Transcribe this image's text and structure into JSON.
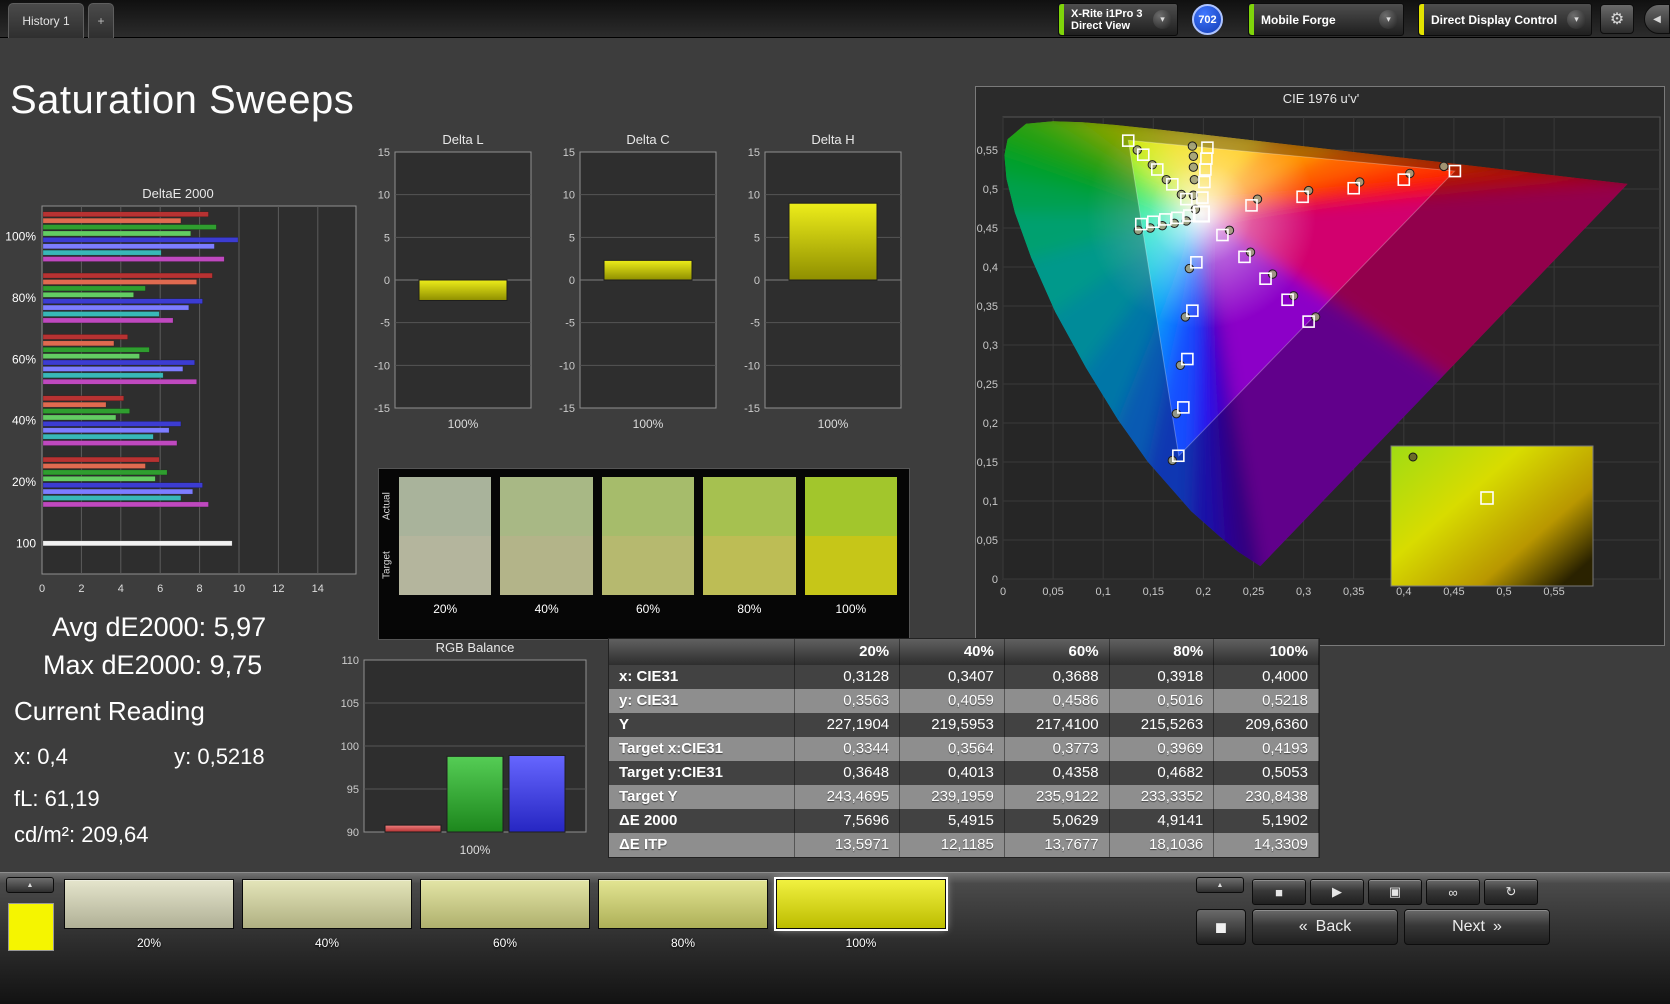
{
  "titlebar": {
    "tab": "History 1",
    "add_tab": "+",
    "meter_line1": "X-Rite i1Pro 3",
    "meter_line2": "Direct View",
    "badge": "702",
    "source_label": "Mobile Forge",
    "display_control_label": "Direct Display Control",
    "accent_green": "#7fd40a",
    "accent_yellow": "#e3e300"
  },
  "icons": {
    "dropdown": "▾",
    "gear": "⚙",
    "collapse": "◀",
    "up": "▲",
    "stop": "■",
    "play": "▶",
    "save": "▣",
    "loop": "∞",
    "refresh": "↻",
    "prev": "«",
    "next": "»",
    "square": "◼"
  },
  "page_title": "Saturation Sweeps",
  "readings": {
    "avg_label": "Avg dE2000: 5,97",
    "max_label": "Max dE2000: 9,75",
    "current_title": "Current Reading",
    "x": "x: 0,4",
    "y": "y: 0,5218",
    "fl": "fL: 61,19",
    "cdm2": "cd/m²: 209,64"
  },
  "chart_data": [
    {
      "id": "deltae2000",
      "type": "bar",
      "orientation": "horizontal",
      "title": "DeltaE 2000",
      "xlim": [
        0,
        14
      ],
      "xticks": [
        0,
        2,
        4,
        6,
        8,
        10,
        12,
        14
      ],
      "bar_colors": [
        "#b83232",
        "#e06a50",
        "#2f9e2f",
        "#63cc63",
        "#3c3cd2",
        "#7d7dff",
        "#38b8b8",
        "#bf49bf"
      ],
      "groups": [
        {
          "label": "100%",
          "values": [
            8.4,
            7.0,
            8.8,
            7.5,
            9.9,
            8.7,
            6.0,
            9.2
          ]
        },
        {
          "label": "80%",
          "values": [
            8.6,
            7.8,
            5.2,
            4.6,
            8.1,
            7.4,
            5.9,
            6.6
          ]
        },
        {
          "label": "60%",
          "values": [
            4.3,
            3.6,
            5.4,
            4.9,
            7.7,
            7.1,
            6.1,
            7.8
          ]
        },
        {
          "label": "40%",
          "values": [
            4.1,
            3.2,
            4.4,
            3.7,
            7.0,
            6.4,
            5.6,
            6.8
          ]
        },
        {
          "label": "20%",
          "values": [
            5.9,
            5.2,
            6.3,
            5.7,
            8.1,
            7.6,
            7.0,
            8.4
          ]
        },
        {
          "label": "100",
          "values": [
            9.6
          ],
          "colors": [
            "#f2f2f2"
          ]
        }
      ]
    },
    {
      "id": "delta_l",
      "type": "bar",
      "title": "Delta L",
      "ylim": [
        -15,
        15
      ],
      "yticks": [
        15,
        10,
        5,
        0,
        -5,
        -10,
        -15
      ],
      "categories": [
        "100%"
      ],
      "values": [
        -2.4
      ],
      "bar_color": "#d9d900"
    },
    {
      "id": "delta_c",
      "type": "bar",
      "title": "Delta C",
      "ylim": [
        -15,
        15
      ],
      "yticks": [
        15,
        10,
        5,
        0,
        -5,
        -10,
        -15
      ],
      "categories": [
        "100%"
      ],
      "values": [
        2.3
      ],
      "bar_color": "#d9d900"
    },
    {
      "id": "delta_h",
      "type": "bar",
      "title": "Delta H",
      "ylim": [
        -15,
        15
      ],
      "yticks": [
        15,
        10,
        5,
        0,
        -5,
        -10,
        -15
      ],
      "categories": [
        "100%"
      ],
      "values": [
        9.0
      ],
      "bar_color": "#d9d900"
    },
    {
      "id": "rgb_balance",
      "type": "bar",
      "title": "RGB Balance",
      "ylim": [
        90,
        110
      ],
      "yticks": [
        110,
        105,
        100,
        95,
        90
      ],
      "categories": [
        "100%"
      ],
      "series": [
        {
          "name": "Red",
          "value": 90.8,
          "color1": "#f08080",
          "color2": "#b43030"
        },
        {
          "name": "Green",
          "value": 98.8,
          "color1": "#55cd55",
          "color2": "#1d871d"
        },
        {
          "name": "Blue",
          "value": 98.9,
          "color1": "#6666ff",
          "color2": "#2626c2"
        }
      ]
    },
    {
      "id": "cie1976",
      "type": "scatter",
      "title": "CIE 1976 u'v'",
      "xticks": [
        "0",
        "0,05",
        "0,1",
        "0,15",
        "0,2",
        "0,25",
        "0,3",
        "0,35",
        "0,4",
        "0,45",
        "0,5",
        "0,55"
      ],
      "yticks": [
        "0",
        "0,05",
        "0,1",
        "0,15",
        "0,2",
        "0,25",
        "0,3",
        "0,35",
        "0,4",
        "0,45",
        "0,5",
        "0,55"
      ],
      "locus_uv": [
        [
          0.2568,
          0.0165
        ],
        [
          0.2347,
          0.035
        ],
        [
          0.2161,
          0.0549
        ],
        [
          0.1877,
          0.0871
        ],
        [
          0.1441,
          0.151
        ],
        [
          0.1147,
          0.2044
        ],
        [
          0.0828,
          0.2708
        ],
        [
          0.0521,
          0.3427
        ],
        [
          0.0282,
          0.4117
        ],
        [
          0.0119,
          0.4699
        ],
        [
          0.0035,
          0.5131
        ],
        [
          0.0014,
          0.5432
        ],
        [
          0.0046,
          0.5639
        ],
        [
          0.0231,
          0.5837
        ],
        [
          0.0501,
          0.5868
        ],
        [
          0.0792,
          0.5856
        ],
        [
          0.1127,
          0.5821
        ],
        [
          0.1531,
          0.5766
        ],
        [
          0.2026,
          0.5694
        ],
        [
          0.2623,
          0.5604
        ],
        [
          0.3315,
          0.5501
        ],
        [
          0.4035,
          0.5393
        ],
        [
          0.4691,
          0.5296
        ],
        [
          0.5203,
          0.5219
        ],
        [
          0.583,
          0.5125
        ],
        [
          0.6234,
          0.5065
        ]
      ],
      "purple_mid": [
        0.44,
        0.26
      ],
      "wedge_colors": [
        "#4600b4",
        "#3c00d2",
        "#2814f0",
        "#1450ff",
        "#0a82ff",
        "#00aaf0",
        "#00c8dc",
        "#00dcc8",
        "#00e6a0",
        "#00e670",
        "#00e646",
        "#0ee62a",
        "#32e61e",
        "#5aeb14",
        "#87eb0a",
        "#b4eb00",
        "#d7e600",
        "#f0dc00",
        "#ffc800",
        "#ff9600",
        "#ff6400",
        "#ff3c00",
        "#ff1e00",
        "#f50a14",
        "#e60028",
        "#d2006e",
        "#8c00c8"
      ],
      "gamut_triangle_uv": [
        [
          0.4507,
          0.5229
        ],
        [
          0.125,
          0.5625
        ],
        [
          0.1754,
          0.1579
        ]
      ],
      "whitepoint_uv": [
        0.1978,
        0.4683
      ],
      "white_target_uv": [
        0.198,
        0.468
      ],
      "targets_uv": [
        [
          0.183,
          0.487
        ],
        [
          0.169,
          0.506
        ],
        [
          0.154,
          0.525
        ],
        [
          0.14,
          0.544
        ],
        [
          0.125,
          0.562
        ],
        [
          0.248,
          0.479
        ],
        [
          0.299,
          0.49
        ],
        [
          0.35,
          0.501
        ],
        [
          0.4,
          0.512
        ],
        [
          0.451,
          0.523
        ],
        [
          0.193,
          0.406
        ],
        [
          0.189,
          0.344
        ],
        [
          0.184,
          0.282
        ],
        [
          0.18,
          0.22
        ],
        [
          0.175,
          0.158
        ],
        [
          0.199,
          0.489
        ],
        [
          0.201,
          0.509
        ],
        [
          0.202,
          0.525
        ],
        [
          0.203,
          0.539
        ],
        [
          0.204,
          0.553
        ],
        [
          0.219,
          0.441
        ],
        [
          0.241,
          0.413
        ],
        [
          0.262,
          0.385
        ],
        [
          0.284,
          0.358
        ],
        [
          0.305,
          0.33
        ],
        [
          0.186,
          0.466
        ],
        [
          0.174,
          0.463
        ],
        [
          0.162,
          0.461
        ],
        [
          0.15,
          0.458
        ],
        [
          0.138,
          0.455
        ]
      ],
      "measurements_uv": [
        [
          0.192,
          0.474
        ],
        [
          0.178,
          0.493
        ],
        [
          0.163,
          0.512
        ],
        [
          0.149,
          0.531
        ],
        [
          0.134,
          0.55
        ],
        [
          0.254,
          0.487
        ],
        [
          0.305,
          0.498
        ],
        [
          0.356,
          0.509
        ],
        [
          0.406,
          0.52
        ],
        [
          0.44,
          0.529
        ],
        [
          0.186,
          0.398
        ],
        [
          0.182,
          0.336
        ],
        [
          0.177,
          0.274
        ],
        [
          0.173,
          0.212
        ],
        [
          0.169,
          0.152
        ],
        [
          0.19,
          0.492
        ],
        [
          0.191,
          0.512
        ],
        [
          0.19,
          0.528
        ],
        [
          0.19,
          0.542
        ],
        [
          0.189,
          0.555
        ],
        [
          0.226,
          0.447
        ],
        [
          0.247,
          0.419
        ],
        [
          0.269,
          0.391
        ],
        [
          0.29,
          0.363
        ],
        [
          0.312,
          0.336
        ],
        [
          0.183,
          0.459
        ],
        [
          0.171,
          0.456
        ],
        [
          0.159,
          0.453
        ],
        [
          0.147,
          0.45
        ],
        [
          0.135,
          0.447
        ]
      ]
    }
  ],
  "swatch_strip": {
    "row_labels": [
      "Actual",
      "Target"
    ],
    "columns": [
      {
        "label": "20%",
        "actual": "#a9b39b",
        "target": "#b4b59d"
      },
      {
        "label": "40%",
        "actual": "#a8b885",
        "target": "#b3b489"
      },
      {
        "label": "60%",
        "actual": "#a6bc6b",
        "target": "#b6b96f"
      },
      {
        "label": "80%",
        "actual": "#a6c150",
        "target": "#bdbd55"
      },
      {
        "label": "100%",
        "actual": "#a2c62c",
        "target": "#c6c618"
      }
    ]
  },
  "table": {
    "header": [
      "",
      "20%",
      "40%",
      "60%",
      "80%",
      "100%"
    ],
    "rows": [
      {
        "label": "x: CIE31",
        "values": [
          "0,3128",
          "0,3407",
          "0,3688",
          "0,3918",
          "0,4000"
        ]
      },
      {
        "label": "y: CIE31",
        "values": [
          "0,3563",
          "0,4059",
          "0,4586",
          "0,5016",
          "0,5218"
        ]
      },
      {
        "label": "Y",
        "values": [
          "227,1904",
          "219,5953",
          "217,4100",
          "215,5263",
          "209,6360"
        ]
      },
      {
        "label": "Target x:CIE31",
        "values": [
          "0,3344",
          "0,3564",
          "0,3773",
          "0,3969",
          "0,4193"
        ]
      },
      {
        "label": "Target y:CIE31",
        "values": [
          "0,3648",
          "0,4013",
          "0,4358",
          "0,4682",
          "0,5053"
        ]
      },
      {
        "label": "Target Y",
        "values": [
          "243,4695",
          "239,1959",
          "235,9122",
          "233,3352",
          "230,8438"
        ]
      },
      {
        "label": "ΔE 2000",
        "values": [
          "7,5696",
          "5,4915",
          "5,0629",
          "4,9141",
          "5,1902"
        ]
      },
      {
        "label": "ΔE ITP",
        "values": [
          "13,5971",
          "12,1185",
          "13,7677",
          "18,1036",
          "14,3309"
        ]
      }
    ]
  },
  "bottom_bar": {
    "current_color": "#f5f500",
    "patches": [
      {
        "label": "20%",
        "color": "#dcdcbb",
        "selected": false
      },
      {
        "label": "40%",
        "color": "#dbdca2",
        "selected": false
      },
      {
        "label": "60%",
        "color": "#dadc88",
        "selected": false
      },
      {
        "label": "80%",
        "color": "#d9dc6e",
        "selected": false
      },
      {
        "label": "100%",
        "color": "#ecec00",
        "selected": true
      }
    ],
    "back_label": "Back",
    "next_label": "Next"
  }
}
